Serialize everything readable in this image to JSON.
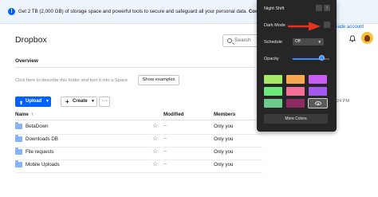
{
  "banner": {
    "text_prefix": "Get 2 TB (2,000 GB) of storage space and powerful tools to secure and safeguard all your personal data.",
    "text_bold": "Compare"
  },
  "header": {
    "logo": "Dropbox",
    "search_placeholder": "Search",
    "upgrade_link": "grade account"
  },
  "overview": {
    "title": "Overview",
    "hint": "Click here to describe this folder and turn it into a Space",
    "show_examples": "Show examples"
  },
  "toolbar": {
    "upload_label": "Upload",
    "create_label": "Create",
    "more_label": "···"
  },
  "table": {
    "columns": {
      "name": "Name",
      "sort_arrow": "↑",
      "modified": "Modified",
      "members": "Members"
    },
    "rows": [
      {
        "name": "BetaDown",
        "modified": "--",
        "members": "Only you"
      },
      {
        "name": "Downloads DB",
        "modified": "--",
        "members": "Only you"
      },
      {
        "name": "File requests",
        "modified": "--",
        "members": "Only you"
      },
      {
        "name": "Mobile Uploads",
        "modified": "--",
        "members": "Only you"
      }
    ]
  },
  "behind": {
    "time": "24 PM"
  },
  "panel": {
    "night_shift": "Night Shift",
    "dark_mode": "Dark Mode",
    "schedule_label": "Schedule",
    "schedule_value": "Off",
    "opacity_label": "Opacity",
    "opacity_level": 0.8,
    "info_glyph": "i",
    "more_colors": "More Colors",
    "swatches": [
      "#a7ea67",
      "#f8a94f",
      "#c95cf2",
      "#6eea7d",
      "#f66f97",
      "#a659f0",
      "#6acb8a",
      "#8d2c63",
      "#5a5a5a"
    ],
    "selected_swatch": 8
  },
  "annotation": {
    "arrow_color": "#e8321e"
  }
}
